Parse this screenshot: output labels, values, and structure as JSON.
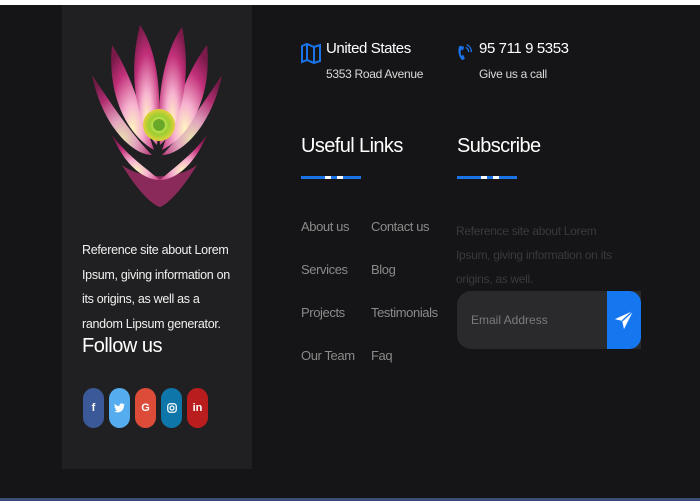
{
  "about": {
    "text": "Reference site about Lorem Ipsum, giving information on its origins, as well as a random Lipsum generator."
  },
  "follow": {
    "title": "Follow us",
    "socials": [
      {
        "name": "facebook-icon",
        "glyph": "f",
        "color": "#3b5998"
      },
      {
        "name": "twitter-icon",
        "glyph": "t",
        "color": "#55acee"
      },
      {
        "name": "google-icon",
        "glyph": "G",
        "color": "#dd4b39"
      },
      {
        "name": "instagram-icon",
        "glyph": "◎",
        "color": "#0e76a8"
      },
      {
        "name": "linkedin-icon",
        "glyph": "in",
        "color": "#b91d1d"
      }
    ]
  },
  "contact": {
    "location": {
      "title": "United States",
      "sub": "5353 Road Avenue",
      "icon": "map-icon"
    },
    "phone": {
      "title": "95 711 9 5353",
      "sub": "Give us a call",
      "icon": "phone-icon"
    }
  },
  "useful_links": {
    "title": "Useful Links",
    "col1": [
      "About us",
      "Services",
      "Projects",
      "Our Team"
    ],
    "col2": [
      "Contact us",
      "Blog",
      "Testimonials",
      "Faq"
    ]
  },
  "subscribe": {
    "title": "Subscribe",
    "text": "Reference site about Lorem Ipsum, giving information on its origins, as well.",
    "placeholder": "Email Address"
  },
  "colors": {
    "accent": "#1a73e8",
    "background": "#151517",
    "panel": "#202022"
  }
}
